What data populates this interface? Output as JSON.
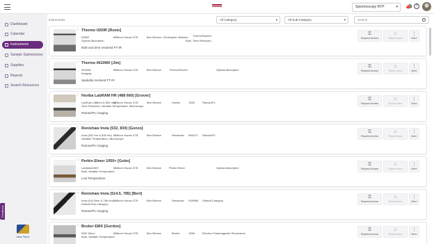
{
  "site_selector": {
    "value": "Spectroscopy RTP"
  },
  "nav": {
    "items": [
      {
        "label": "Dashboard"
      },
      {
        "label": "Calendar"
      },
      {
        "label": "Instruments"
      },
      {
        "label": "Sample Submissions"
      },
      {
        "label": "Supplies"
      },
      {
        "label": "Reports"
      },
      {
        "label": "Search Resources"
      }
    ],
    "active": "Instruments"
  },
  "brand": {
    "text": "Idea Place"
  },
  "feedback": {
    "label": "Feedback"
  },
  "breadcrumb": "Instruments",
  "filters": {
    "category": "All Category",
    "sub_category": "All Sub-Category",
    "search_placeholder": "Search"
  },
  "actions": {
    "request": "Request Access",
    "report": "Report Issue",
    "more": "More"
  },
  "instruments": [
    {
      "title": "Thermo iS50R [Rosie]",
      "model": "IS50R",
      "location": "Millburn House G78",
      "people": "Ben Breeze, Christopher Waldron",
      "maker": "ThermoFischer",
      "category": "Optical Absorption",
      "subcategory": "Bulk, Time Resolved",
      "description": "Bulk and time resolved FT-IR"
    },
    {
      "title": "Thermo iN10MX [Jim]",
      "model": "IN10Mx",
      "location": "Millburn House G78",
      "people": "Ben Breeze",
      "maker": "ThermoFischer",
      "category": "Optical Absorption",
      "subcategory": "Imaging",
      "description": "Spatially resolved FT-IR"
    },
    {
      "title": "Horiba LabRAM HR (488 660) [Grover]",
      "model": "LabRam (488nm & 660 nm)",
      "location": "Millburn House G78",
      "people": "Ben Breeze",
      "maker": "Horiba",
      "code": "1359",
      "category": "Raman/PL",
      "subcategory": "Time Resolved, Variable Temperature, Microscope",
      "description": "Raman/PL imaging"
    },
    {
      "title": "Renishaw Invia (532, 830) [Gonzo]",
      "model": "Invia (532 nm & 830 nm)",
      "location": "Millburn House G78",
      "people": "Ben Breeze",
      "maker": "Renishaw",
      "code": "546472",
      "category": "Raman/PL",
      "subcategory": "Variable Temperature, Microscope",
      "description": "Raman/PL imaging"
    },
    {
      "title": "Perkin Elmer 1050+ [Gobo]",
      "model": "Lambda1050+",
      "location": "Millburn House G78",
      "people": "Ben Breeze",
      "maker": "Perkin Elmer",
      "category": "Optical Absorption",
      "subcategory": "Bulk, Variable Temperature",
      "description": "Low Temperature"
    },
    {
      "title": "Renishaw Invia (514.5, 785) [Bert]",
      "model": "Invia (514.5nm & 785 nm)",
      "location": "Millburn House G78",
      "people": "Ben Breeze",
      "maker": "Renishaw",
      "code": "H29866",
      "category": "Default Category",
      "subcategory": "Default Sub-Category",
      "description": "Raman/PL imaging"
    },
    {
      "title": "Bruker EMX [Gordon]",
      "model": "EMX Micro",
      "location": "Millburn House G78",
      "people": "Ben Breeze",
      "maker": "Bruker",
      "code": "1366",
      "category": "Electron Paramagnetic Resonance",
      "subcategory": "Bulk, Variable Temperature",
      "description": ""
    }
  ],
  "colors": {
    "accent": "#6a2c7c",
    "brand_red": "#a0213a"
  },
  "icons": {
    "menu": "hamburger-icon",
    "notify": "megaphone-icon",
    "help": "help-icon",
    "request": "key-icon",
    "report": "warning-icon",
    "more": "kebab-icon",
    "favorite": "heart-icon"
  }
}
